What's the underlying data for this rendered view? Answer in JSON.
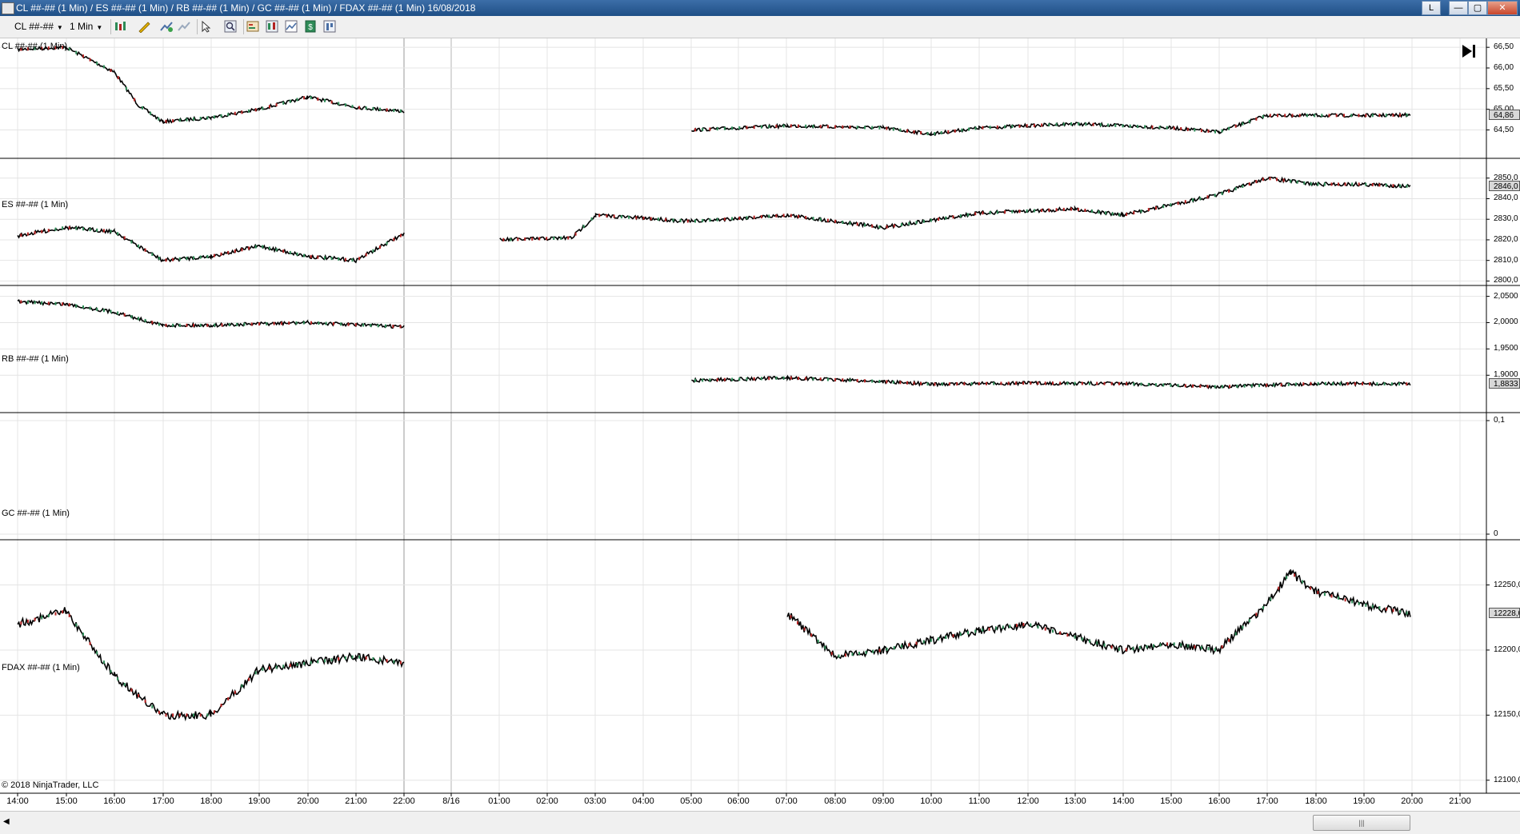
{
  "window": {
    "title": "CL ##-## (1 Min) / ES ##-## (1 Min) / RB ##-## (1 Min) / GC ##-## (1 Min) / FDAX ##-## (1 Min)  16/08/2018",
    "buttons": {
      "l": "L",
      "minimize": "—",
      "maximize": "▢",
      "close": "✕"
    }
  },
  "toolbar": {
    "instrument": "CL ##-##",
    "interval": "1 Min",
    "icons": [
      "bar-style-icon",
      "drawing-tool-icon",
      "add-indicator-icon",
      "strategy-icon",
      "cursor-icon",
      "zoom-icon",
      "data-box-icon",
      "chart-trader-icon",
      "chart-style-icon",
      "order-icon",
      "properties-icon"
    ]
  },
  "panels": [
    {
      "name": "cl",
      "label": "CL ##-## (1 Min)",
      "axis": [
        "66,50",
        "66,00",
        "65,50",
        "65,00",
        "64,50"
      ],
      "price_tag": "64,86",
      "color": "#000000"
    },
    {
      "name": "es",
      "label": "ES ##-## (1 Min)",
      "axis": [
        "2850,0",
        "2840,0",
        "2830,0",
        "2820,0",
        "2810,0",
        "2800,0"
      ],
      "price_tag": "2846,0",
      "color": "#000000"
    },
    {
      "name": "rb",
      "label": "RB ##-## (1 Min)",
      "axis": [
        "2,0500",
        "2,0000",
        "1,9500",
        "1,9000"
      ],
      "price_tag": "1,8833",
      "color": "#000000"
    },
    {
      "name": "gc",
      "label": "GC ##-## (1 Min)",
      "axis": [
        "0,1",
        "0"
      ],
      "price_tag": "",
      "color": "#000000"
    },
    {
      "name": "fdax",
      "label": "FDAX ##-## (1 Min)",
      "axis": [
        "12250,0",
        "12200,0",
        "12150,0",
        "12100,0"
      ],
      "price_tag": "12228,0",
      "color": "#000000"
    }
  ],
  "x_axis": [
    "14:00",
    "15:00",
    "16:00",
    "17:00",
    "18:00",
    "19:00",
    "20:00",
    "21:00",
    "22:00",
    "8/16",
    "01:00",
    "02:00",
    "03:00",
    "04:00",
    "05:00",
    "06:00",
    "07:00",
    "08:00",
    "09:00",
    "10:00",
    "11:00",
    "12:00",
    "13:00",
    "14:00",
    "15:00",
    "16:00",
    "17:00",
    "18:00",
    "19:00",
    "20:00",
    "21:00"
  ],
  "copyright": "© 2018 NinjaTrader, LLC",
  "colors": {
    "up_candle": "#2e8b57",
    "down_candle": "#b22222",
    "grid": "#e4e4e4",
    "separator": "#000000"
  },
  "chart_data": [
    {
      "type": "line",
      "title": "CL ##-## (1 Min)",
      "ylim": [
        64.2,
        66.6
      ],
      "series": [
        {
          "name": "CL ##-##",
          "x": [
            "14:00",
            "15:00",
            "16:00",
            "16:30",
            "17:00",
            "18:00",
            "19:00",
            "20:00",
            "21:00",
            "22:00",
            "06:00",
            "08:00",
            "10:00",
            "11:00",
            "12:00",
            "14:00",
            "16:00",
            "17:00",
            "18:00",
            "20:00",
            "21:00"
          ],
          "values": [
            66.45,
            66.5,
            65.9,
            65.1,
            64.7,
            64.8,
            65.0,
            65.3,
            65.05,
            64.95,
            64.5,
            64.6,
            64.55,
            64.4,
            64.55,
            64.65,
            64.55,
            64.45,
            64.85,
            64.85,
            64.86
          ]
        }
      ]
    },
    {
      "type": "line",
      "title": "ES ##-## (1 Min)",
      "ylim": [
        2799,
        2853
      ],
      "series": [
        {
          "name": "ES ##-##",
          "x": [
            "14:00",
            "15:00",
            "16:00",
            "17:00",
            "18:00",
            "19:00",
            "20:00",
            "21:00",
            "22:00",
            "02:00",
            "03:30",
            "04:00",
            "06:00",
            "08:00",
            "10:00",
            "12:00",
            "14:00",
            "15:00",
            "17:00",
            "18:00",
            "19:00",
            "20:00",
            "21:00"
          ],
          "values": [
            2822,
            2826,
            2824,
            2810,
            2812,
            2817,
            2812,
            2810,
            2823,
            2820,
            2821,
            2832,
            2829,
            2832,
            2826,
            2833,
            2835,
            2832,
            2842,
            2850,
            2847,
            2847,
            2846
          ]
        }
      ]
    },
    {
      "type": "line",
      "title": "RB ##-## (1 Min)",
      "ylim": [
        1.87,
        2.06
      ],
      "series": [
        {
          "name": "RB ##-##",
          "x": [
            "14:00",
            "15:00",
            "16:00",
            "17:00",
            "18:00",
            "20:00",
            "22:00",
            "06:00",
            "08:00",
            "10:00",
            "11:00",
            "13:00",
            "15:00",
            "17:00",
            "19:00",
            "21:00"
          ],
          "values": [
            2.04,
            2.035,
            2.02,
            1.995,
            1.995,
            2.0,
            1.992,
            1.89,
            1.895,
            1.888,
            1.883,
            1.885,
            1.884,
            1.878,
            1.884,
            1.8833
          ]
        }
      ]
    },
    {
      "type": "line",
      "title": "GC ##-## (1 Min)",
      "ylim": [
        0,
        0.1
      ],
      "series": []
    },
    {
      "type": "line",
      "title": "FDAX ##-## (1 Min)",
      "ylim": [
        12090,
        12270
      ],
      "series": [
        {
          "name": "FDAX ##-##",
          "x": [
            "14:00",
            "15:00",
            "16:00",
            "17:00",
            "18:00",
            "19:00",
            "20:00",
            "21:00",
            "22:00",
            "08:00",
            "09:00",
            "10:00",
            "12:00",
            "13:00",
            "15:00",
            "16:00",
            "17:00",
            "18:00",
            "18:30",
            "19:00",
            "20:00",
            "21:00"
          ],
          "values": [
            12220,
            12230,
            12180,
            12150,
            12150,
            12185,
            12190,
            12195,
            12190,
            12228,
            12195,
            12200,
            12215,
            12220,
            12200,
            12205,
            12200,
            12235,
            12260,
            12245,
            12235,
            12228
          ]
        }
      ]
    }
  ]
}
